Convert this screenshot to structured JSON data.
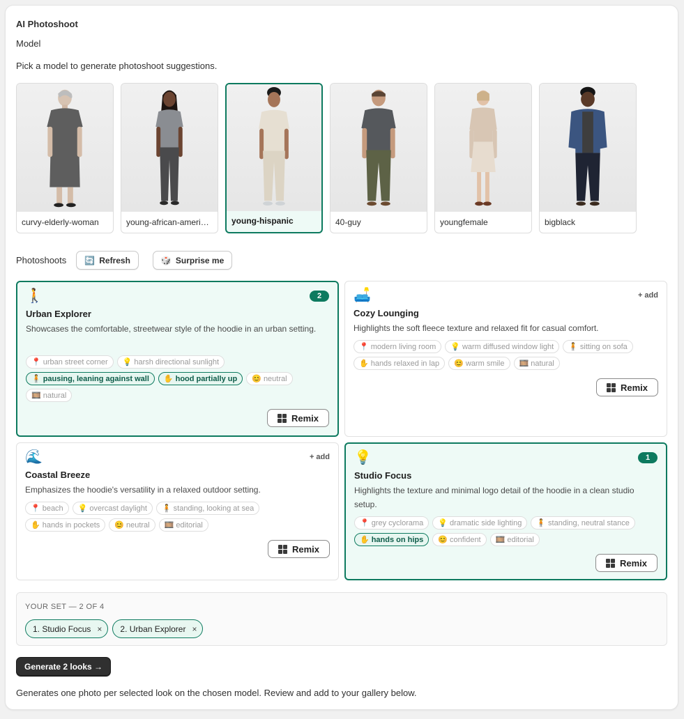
{
  "app": {
    "title": "AI Photoshoot"
  },
  "model_section": {
    "label": "Model",
    "hint": "Pick a model to generate photoshoot suggestions.",
    "models": [
      {
        "name": "curvy-elderly-woman",
        "selected": false
      },
      {
        "name": "young-african-american-woman",
        "selected": false
      },
      {
        "name": "young-hispanic",
        "selected": true
      },
      {
        "name": "40-guy",
        "selected": false
      },
      {
        "name": "youngfemale",
        "selected": false
      },
      {
        "name": "bigblack",
        "selected": false
      }
    ]
  },
  "photoshoots": {
    "label": "Photoshoots",
    "refresh_label": "Refresh",
    "surprise_label": "Surprise me",
    "remix_label": "Remix",
    "add_label": "+ add",
    "cards": [
      {
        "emoji": "🚶",
        "name": "Urban Explorer",
        "desc": "Showcases the comfortable, streetwear style of the hoodie in an urban setting.",
        "count": "2",
        "tags": [
          {
            "icon": "📍",
            "text": "urban street corner",
            "on": false
          },
          {
            "icon": "💡",
            "text": "harsh directional sunlight",
            "on": false
          },
          {
            "icon": "🧍",
            "text": "pausing, leaning against wall",
            "on": true
          },
          {
            "icon": "✋",
            "text": "hood partially up",
            "on": true
          },
          {
            "icon": "😊",
            "text": "neutral",
            "on": false
          },
          {
            "icon": "🎞️",
            "text": "natural",
            "on": false
          }
        ]
      },
      {
        "emoji": "🛋️",
        "name": "Cozy Lounging",
        "desc": "Highlights the soft fleece texture and relaxed fit for casual comfort.",
        "count": "",
        "tags": [
          {
            "icon": "📍",
            "text": "modern living room",
            "on": false
          },
          {
            "icon": "💡",
            "text": "warm diffused window light",
            "on": false
          },
          {
            "icon": "🧍",
            "text": "sitting on sofa",
            "on": false
          },
          {
            "icon": "✋",
            "text": "hands relaxed in lap",
            "on": false
          },
          {
            "icon": "😊",
            "text": "warm smile",
            "on": false
          },
          {
            "icon": "🎞️",
            "text": "natural",
            "on": false
          }
        ]
      },
      {
        "emoji": "🌊",
        "name": "Coastal Breeze",
        "desc": "Emphasizes the hoodie's versatility in a relaxed outdoor setting.",
        "count": "",
        "tags": [
          {
            "icon": "📍",
            "text": "beach",
            "on": false
          },
          {
            "icon": "💡",
            "text": "overcast daylight",
            "on": false
          },
          {
            "icon": "🧍",
            "text": "standing, looking at sea",
            "on": false
          },
          {
            "icon": "✋",
            "text": "hands in pockets",
            "on": false
          },
          {
            "icon": "😊",
            "text": "neutral",
            "on": false
          },
          {
            "icon": "🎞️",
            "text": "editorial",
            "on": false
          }
        ]
      },
      {
        "emoji": "💡",
        "name": "Studio Focus",
        "desc": "Highlights the texture and minimal logo detail of the hoodie in a clean studio setup.",
        "count": "1",
        "tags": [
          {
            "icon": "📍",
            "text": "grey cyclorama",
            "on": false
          },
          {
            "icon": "💡",
            "text": "dramatic side lighting",
            "on": false
          },
          {
            "icon": "🧍",
            "text": "standing, neutral stance",
            "on": false
          },
          {
            "icon": "✋",
            "text": "hands on hips",
            "on": true
          },
          {
            "icon": "😊",
            "text": "confident",
            "on": false
          },
          {
            "icon": "🎞️",
            "text": "editorial",
            "on": false
          }
        ]
      }
    ]
  },
  "your_set": {
    "title": "YOUR SET — 2 OF 4",
    "chips": [
      "1. Studio Focus",
      "2. Urban Explorer"
    ],
    "remove_glyph": "×"
  },
  "generate_label": "Generate 2 looks →",
  "footer_note": "Generates one photo per selected look on the chosen model. Review and add to your gallery below.",
  "colors": {
    "accent": "#0d7a5f",
    "accent_bg": "#eefaf6",
    "text": "#303030"
  }
}
